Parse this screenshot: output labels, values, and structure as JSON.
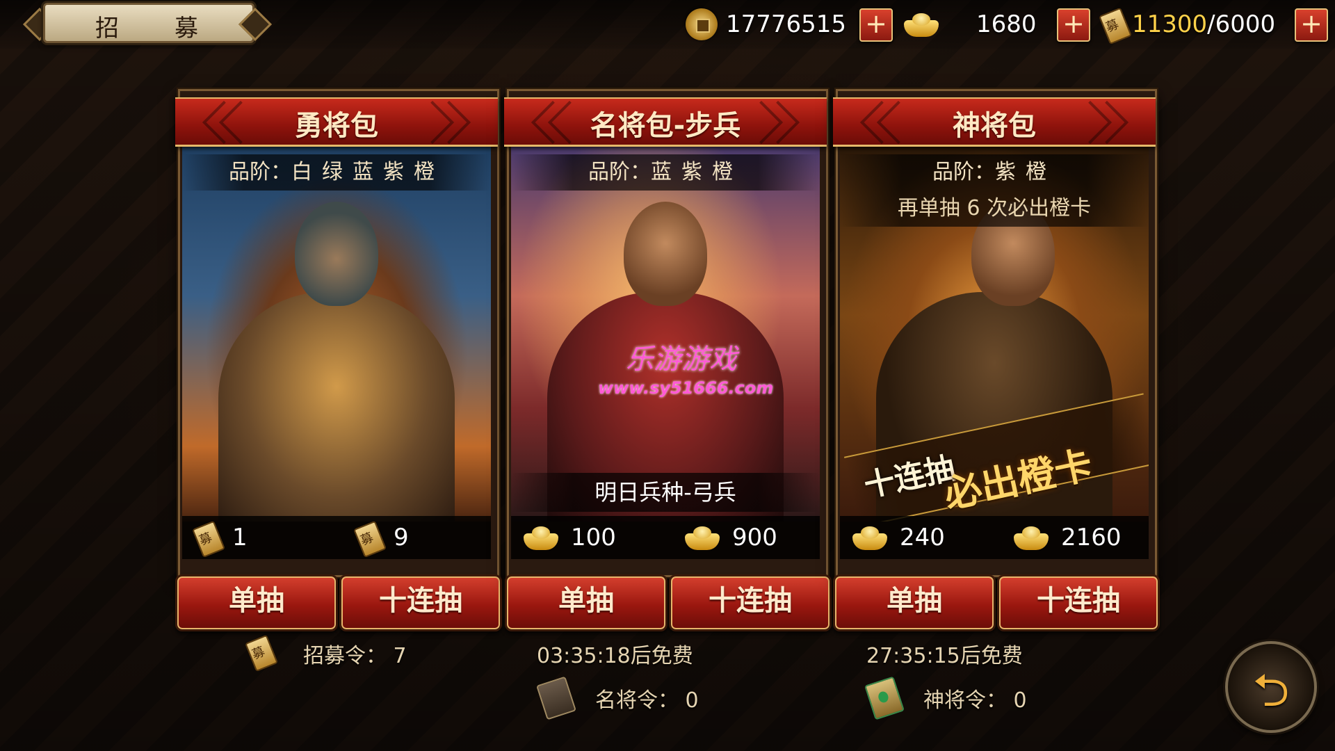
{
  "screen_title": {
    "char1": "招",
    "char2": "募"
  },
  "currencies": {
    "copper": "17776515",
    "gold": "1680",
    "stamina_current": "11300",
    "stamina_separator": "/",
    "stamina_max": " 6000",
    "plus_label": "+"
  },
  "packs": [
    {
      "title": "勇将包",
      "quality_label": "品阶：",
      "quality_values": "白绿蓝紫橙",
      "single_cost": "1",
      "ten_cost": "9",
      "cost_currency": "recruit-token-icon",
      "single_button": "单抽",
      "ten_button": "十连抽"
    },
    {
      "title": "名将包-步兵",
      "quality_label": "品阶：",
      "quality_values": "蓝紫橙",
      "next_unit": "明日兵种-弓兵",
      "single_cost": "100",
      "ten_cost": "900",
      "cost_currency": "gold-ingot-icon",
      "single_button": "单抽",
      "ten_button": "十连抽"
    },
    {
      "title": "神将包",
      "quality_label": "品阶：",
      "quality_values": "紫橙",
      "pity_text": "再单抽 6 次必出橙卡",
      "banner_line1": "十连抽",
      "banner_line2": "必出橙卡",
      "single_cost": "240",
      "ten_cost": "2160",
      "cost_currency": "gold-ingot-icon",
      "single_button": "单抽",
      "ten_button": "十连抽"
    }
  ],
  "footer": {
    "recruit_token": "招募令：  7",
    "famous_timer": "03:35:18后免费",
    "famous_token": "名将令：  0",
    "divine_timer": "27:35:15后免费",
    "divine_token": "神将令：  0"
  },
  "watermark": {
    "line1": "乐游游戏",
    "line2": "www.sy51666.com"
  },
  "back_button": {
    "icon": "back-arrow-icon",
    "glyph": "⮌"
  },
  "colors": {
    "header_red": "#c72a1c",
    "button_red": "#d6402e",
    "gold_trim": "#e6b96a",
    "stamina_yellow": "#ffd24a"
  }
}
